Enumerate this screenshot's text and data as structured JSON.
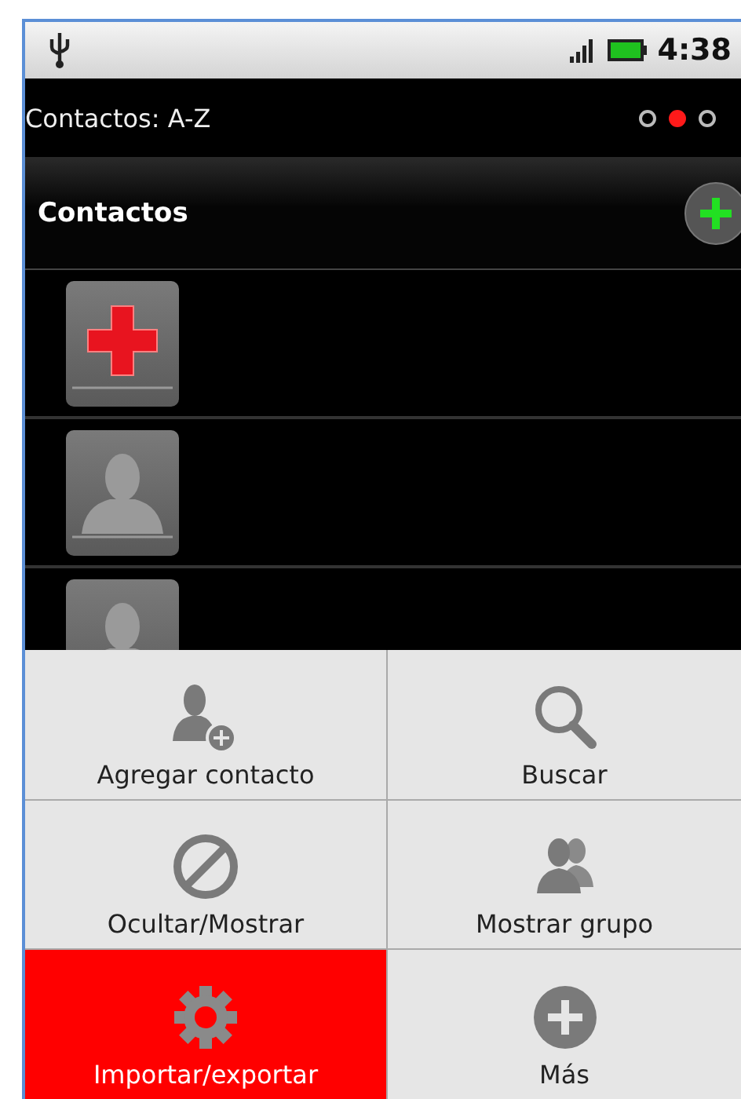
{
  "status_bar": {
    "time": "4:38"
  },
  "title_bar": {
    "title": "Contactos: A-Z",
    "pages": [
      {
        "selected": false
      },
      {
        "selected": true
      },
      {
        "selected": false
      }
    ]
  },
  "header": {
    "title": "Contactos"
  },
  "contacts": [
    {
      "kind": "emergency"
    },
    {
      "kind": "person"
    },
    {
      "kind": "person"
    }
  ],
  "menu": [
    {
      "kind": "add-contact",
      "label": "Agregar contacto",
      "selected": false
    },
    {
      "kind": "search",
      "label": "Buscar",
      "selected": false
    },
    {
      "kind": "hide",
      "label": "Ocultar/Mostrar",
      "selected": false
    },
    {
      "kind": "group",
      "label": "Mostrar grupo",
      "selected": false
    },
    {
      "kind": "settings",
      "label": "Importar/exportar",
      "selected": true
    },
    {
      "kind": "more",
      "label": "Más",
      "selected": false
    }
  ]
}
